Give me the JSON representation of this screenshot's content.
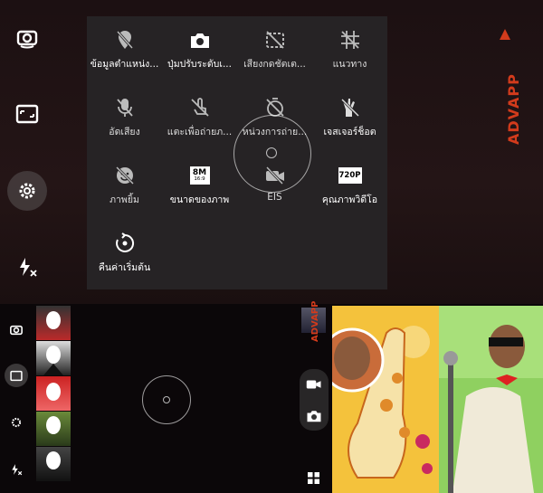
{
  "settings_menu": {
    "items": [
      {
        "label": "ข้อมูลตำแหน่ง...",
        "icon": "location-off-icon"
      },
      {
        "label": "ปุ่มปรับระดับเ...",
        "icon": "camera-icon"
      },
      {
        "label": "เสียงกดชัตเต...",
        "icon": "shutter-sound-off-icon"
      },
      {
        "label": "แนวทาง",
        "icon": "grid-off-icon"
      },
      {
        "label": "อัดเสียง",
        "icon": "mic-off-icon"
      },
      {
        "label": "แตะเพื่อถ่ายภ...",
        "icon": "touch-capture-off-icon"
      },
      {
        "label": "หน่วงการถ่าย...",
        "icon": "timer-off-icon"
      },
      {
        "label": "เจสเจอร์ช็อต",
        "icon": "gesture-off-icon"
      },
      {
        "label": "ภาพยิ้ม",
        "icon": "smile-off-icon"
      },
      {
        "label": "ขนาดของภาพ",
        "icon": "image-size-icon",
        "badge": "8M",
        "badge_sub": "16:9"
      },
      {
        "label": "EIS",
        "icon": "eis-off-icon"
      },
      {
        "label": "คุณภาพวิดีโอ",
        "icon": "video-quality-icon",
        "badge": "720P"
      },
      {
        "label": "คืนค่าเริ่มต้น",
        "icon": "reset-icon"
      }
    ]
  },
  "left_sidebar": {
    "buttons": [
      {
        "name": "switch-camera",
        "icon": "switch-camera-icon"
      },
      {
        "name": "gallery-mode",
        "icon": "gallery-icon"
      },
      {
        "name": "settings",
        "icon": "gear-icon",
        "active": true
      },
      {
        "name": "flash",
        "icon": "flash-off-icon"
      }
    ]
  },
  "watermark": {
    "text": "ADVAPP"
  },
  "colors": {
    "accent": "#d23b1c",
    "panel": "#262426"
  }
}
